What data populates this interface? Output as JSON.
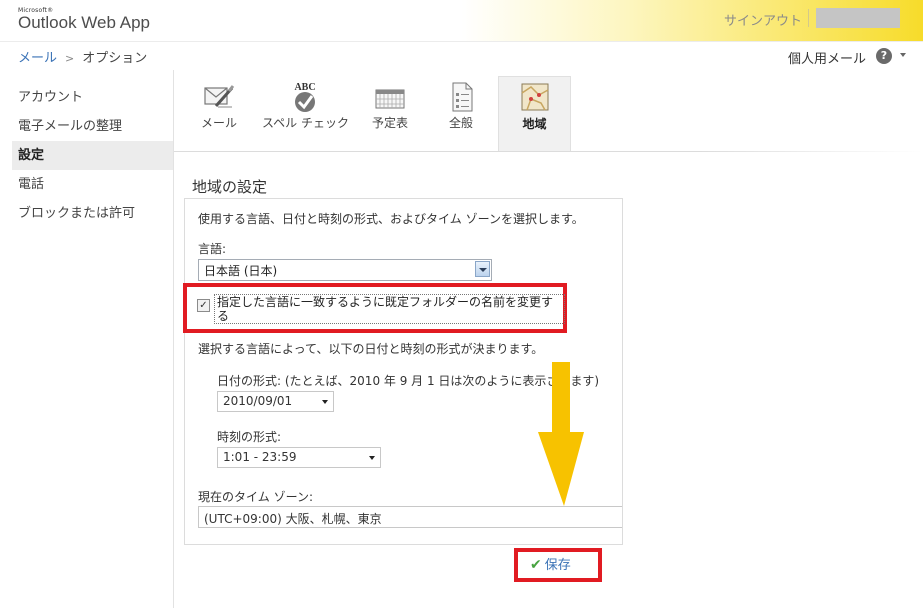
{
  "header": {
    "brand_small": "Microsoft®",
    "brand_name": "Outlook Web App",
    "signout": "サインアウト"
  },
  "breadcrumb": {
    "parent": "メール",
    "current": "オプション"
  },
  "personal_mail": "個人用メール",
  "help": "?",
  "left_nav": [
    {
      "label": "アカウント"
    },
    {
      "label": "電子メールの整理"
    },
    {
      "label": "設定",
      "active": true
    },
    {
      "label": "電話"
    },
    {
      "label": "ブロックまたは許可"
    }
  ],
  "tabs": [
    {
      "label": "メール",
      "icon": "mail-pen-icon"
    },
    {
      "label": "スペル チェック",
      "icon": "spellcheck-icon",
      "icon_text": "ABC"
    },
    {
      "label": "予定表",
      "icon": "calendar-icon"
    },
    {
      "label": "全般",
      "icon": "general-document-icon"
    },
    {
      "label": "地域",
      "icon": "region-map-icon",
      "active": true
    }
  ],
  "region": {
    "title": "地域の設定",
    "description": "使用する言語、日付と時刻の形式、およびタイム ゾーンを選択します。",
    "language_label": "言語:",
    "language_value": "日本語 (日本)",
    "rename_folders_checked": true,
    "rename_folders_label": "指定した言語に一致するように既定フォルダーの名前を変更する",
    "format_note": "選択する言語によって、以下の日付と時刻の形式が決まります。",
    "date_label": "日付の形式: (たとえば、2010 年 9 月 1 日は次のように表示されます)",
    "date_value": "2010/09/01",
    "time_label": "時刻の形式:",
    "time_value": "1:01 - 23:59",
    "timezone_label": "現在のタイム ゾーン:",
    "timezone_value": "(UTC+09:00) 大阪、札幌、東京"
  },
  "save_label": "保存",
  "colors": {
    "highlight_red": "#e11b22",
    "arrow_yellow": "#f7c200",
    "link_blue": "#3a72b6"
  }
}
